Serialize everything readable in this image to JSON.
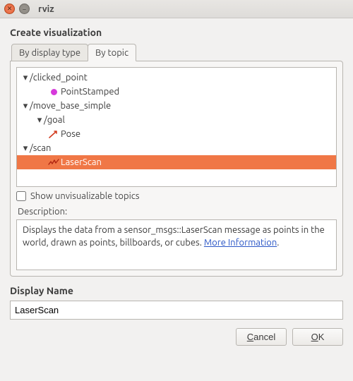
{
  "window": {
    "title": "rviz"
  },
  "header": "Create visualization",
  "tabs": {
    "by_display_type": "By display type",
    "by_topic": "By topic",
    "active": 1
  },
  "tree": {
    "clicked_point": {
      "label": "/clicked_point",
      "child_label": "PointStamped"
    },
    "move_base_simple": {
      "label": "/move_base_simple",
      "goal": {
        "label": "/goal",
        "child_label": "Pose"
      }
    },
    "scan": {
      "label": "/scan",
      "child_label": "LaserScan"
    }
  },
  "show_unvisualizable": {
    "label": "Show unvisualizable topics",
    "checked": false
  },
  "description": {
    "label": "Description:",
    "text": "Displays the data from a sensor_msgs::LaserScan message as points in the world, drawn as points, billboards, or cubes. ",
    "link_text": "More Information"
  },
  "display_name": {
    "label": "Display Name",
    "value": "LaserScan"
  },
  "buttons": {
    "cancel": "Cancel",
    "ok": "OK",
    "cancel_mn": "C",
    "ok_mn": "O"
  }
}
